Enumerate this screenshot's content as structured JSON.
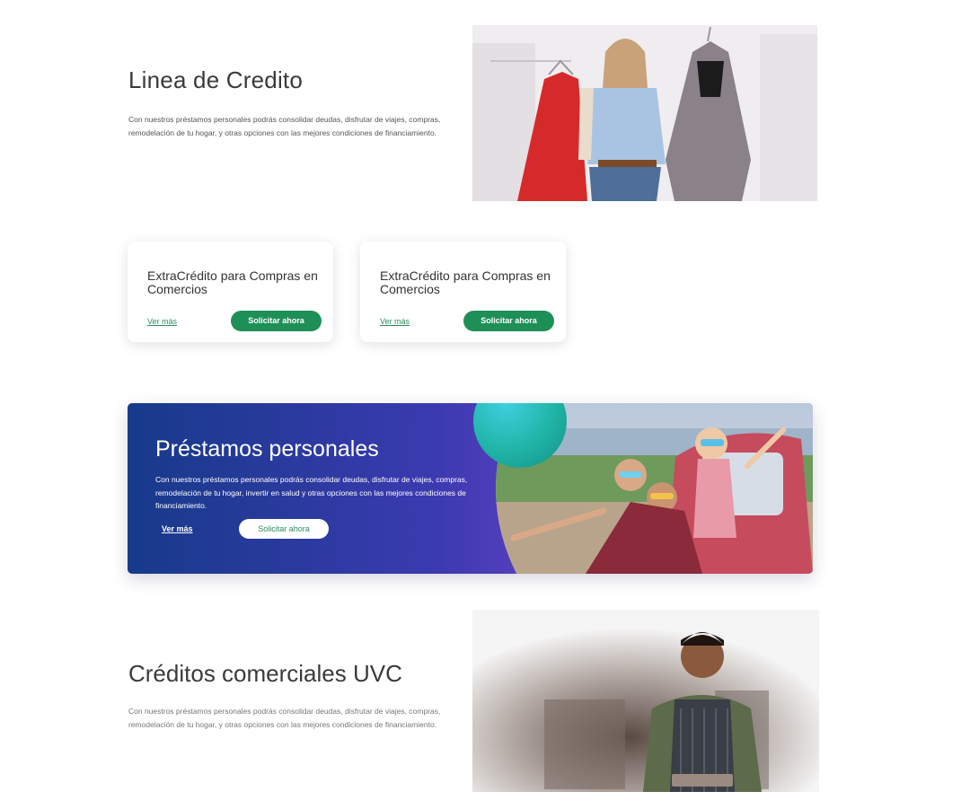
{
  "section1": {
    "title": "Linea de Credito",
    "text": "Con nuestros préstamos personales podrás consolidar deudas, disfrutar de viajes, compras, remodelación de tu hogar, y otras opciones con las mejores condiciones de financiamiento."
  },
  "cards": [
    {
      "title": "ExtraCrédito para Compras en Comercios",
      "link": "Ver más",
      "button": "Solicitar ahora"
    },
    {
      "title": "ExtraCrédito para Compras en Comercios",
      "link": "Ver más",
      "button": "Solicitar ahora"
    }
  ],
  "banner": {
    "title": "Préstamos personales",
    "text": "Con nuestros préstamos personales podrás consolidar deudas, disfrutar de viajes, compras, remodelación de tu hogar, invertir en salud y otras opciones con las mejores condiciones de financiamiento.",
    "link": "Ver más",
    "button": "Solicitar ahora"
  },
  "section4": {
    "title": "Créditos comerciales UVC",
    "text": "Con nuestros préstamos personales podrás consolidar deudas, disfrutar de viajes, compras, remodelación de tu hogar, y otras opciones con las mejores condiciones de financiamiento."
  },
  "colors": {
    "accent_green": "#1f8f58",
    "banner_blue": "#173a8a",
    "banner_purple": "#6b4ac4"
  }
}
